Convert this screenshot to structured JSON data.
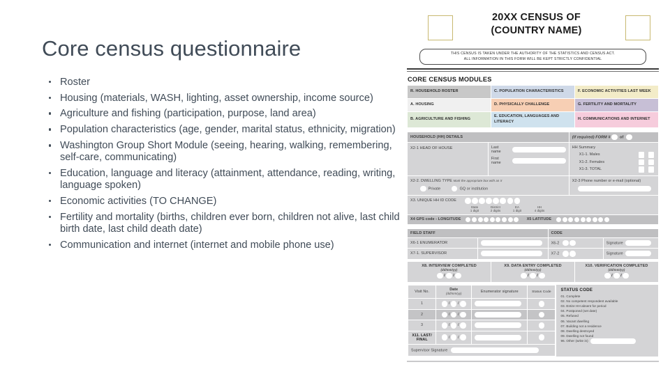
{
  "slide": {
    "title": "Core census questionnaire",
    "bullets": [
      "Roster",
      "Housing (materials, WASH, lighting, asset ownership, income source)",
      "Agriculture and fishing (participation, purpose, land area)",
      "Population characteristics (age, gender, marital status, ethnicity, migration)",
      "Washington Group Short Module (seeing, hearing, walking, remembering, self-care, communicating)",
      "Education, language and literacy (attainment, attendance, reading, writing, language spoken)",
      "Economic activities (TO CHANGE)",
      "Fertility and mortality (births, children ever born, children not alive, last child birth date, last child death date)",
      "Communication and internet (internet and mobile phone use)"
    ],
    "text_color": "#404b57"
  },
  "form": {
    "header": {
      "title_line1": "20XX CENSUS OF",
      "title_line2": "(COUNTRY NAME)",
      "authority_line1": "THIS CENSUS IS TAKEN UNDER THE AUTHORITY OF THE STATISTICS AND CENSUS ACT.",
      "authority_line2": "ALL INFORMATION IN THIS FORM WILL BE KEPT STRICTLY CONFIDENTIAL"
    },
    "modules": {
      "heading": "CORE CENSUS MODULES",
      "cells": [
        {
          "label": "R. HOUSEHOLD ROSTER",
          "color": "#c8c8c8"
        },
        {
          "label": "C. POPULATION CHARACTERISTICS",
          "color": "#cfd9e8"
        },
        {
          "label": "F. ECONOMIC ACTIVITIES LAST WEEK",
          "color": "#f3ecc8"
        },
        {
          "label": "A. HOUSING",
          "color": "#f0f0f0"
        },
        {
          "label": "D. PHYSICALLY CHALLENGE",
          "color": "#f7cfb4"
        },
        {
          "label": "G. FERTILITY AND MORTALITY",
          "color": "#c7bfd6"
        },
        {
          "label": "B. AGRICULTURE AND FISHING",
          "color": "#dde8d6"
        },
        {
          "label": "E. EDUCATION, LANGUAGES AND LITERACY",
          "color": "#cfe2ee"
        },
        {
          "label": "H. COMMUNICATIONS AND INTERNET",
          "color": "#f6ccdc"
        }
      ]
    },
    "household": {
      "band_label": "HOUSEHOLD (HH) DETAILS",
      "form_number_label": "(If required)  FORM #",
      "form_of": "of",
      "head_of_house": "X2-1  HEAD OF HOUSE",
      "last_name": "Last name",
      "first_name": "First name",
      "hh_summary": "HH Summary",
      "males": "X1-1. Males",
      "females": "X1-2. Females",
      "total": "X1-3. TOTAL",
      "dwelling_type": "X2-2. DWELLING TYPE",
      "dwelling_type_note": "Mark the appropriate box with an X",
      "dwelling_private": "Private",
      "dwelling_gq": "GQ or institution",
      "phone": "X2-3  Phone number or e-mail (optional)",
      "unique_id": "X3. UNIQUE HH ID CODE",
      "id_parts": [
        {
          "name": "State",
          "digits": "1 digit"
        },
        {
          "name": "District",
          "digits": "2 digits"
        },
        {
          "name": "EA",
          "digits": "1 digit"
        },
        {
          "name": "HH",
          "digits": "4 digits"
        }
      ],
      "gps_longitude": "X4 GPS code - LONGITUDE",
      "gps_latitude": "X5 LATITUDE"
    },
    "field_staff": {
      "band_label": "FIELD STAFF",
      "code_label": "CODE",
      "enumerator": "X6-1  ENUMERATOR",
      "supervisor": "X7-1. SUPERVISOR",
      "enumerator_code": "X6-2",
      "supervisor_code": "X7-2",
      "signature": "Signature",
      "completed": [
        {
          "label": "X8. INTERVIEW COMPLETED",
          "note": "(dd/mm/yy)"
        },
        {
          "label": "X9. DATA ENTRY COMPLETED",
          "note": "(dd/mm/yy)"
        },
        {
          "label": "X10. VERIFICATION COMPLETED",
          "note": "(dd/mm/yy)"
        }
      ]
    },
    "visits": {
      "columns": [
        "Visit No.",
        "Date",
        "Enumerator signature",
        "Status Code"
      ],
      "date_note": "(dd/mm/yy)",
      "rows": [
        "1",
        "2",
        "3"
      ],
      "last_final": "X11. LAST/ FINAL",
      "supervisor_signature": "Supervisor Signature"
    },
    "status": {
      "heading": "STATUS CODE",
      "codes": [
        "01. Complete",
        "02. No competent respondent available",
        "03. Entire HH absent for period",
        "04. Postponed (set date)",
        "05. Refused",
        "06. Vacant dwelling",
        "07. Building not a residence",
        "08. Dwelling destroyed",
        "09. Dwelling not found",
        "96. Other (write in)"
      ]
    }
  }
}
